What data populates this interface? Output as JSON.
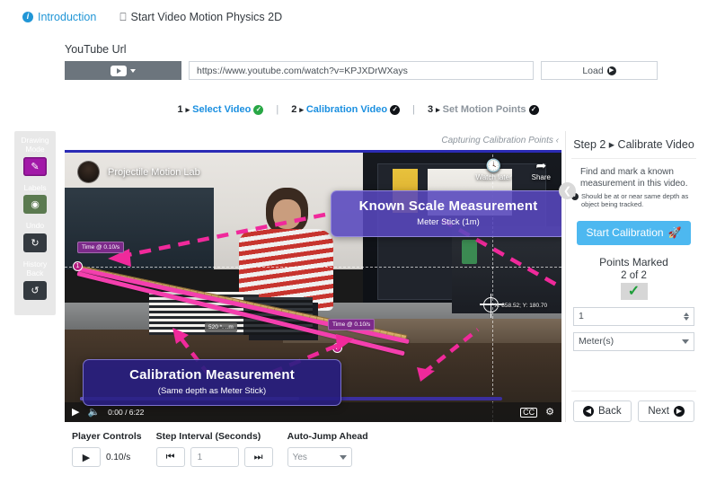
{
  "topnav": {
    "tabs": [
      {
        "label": "Introduction",
        "icon": "info-icon",
        "active": true
      },
      {
        "label": "Start Video Motion Physics 2D",
        "icon": "monitor-icon",
        "active": false
      }
    ]
  },
  "url_form": {
    "label": "YouTube Url",
    "source_button": "youtube-source",
    "value": "https://www.youtube.com/watch?v=KPJXDrWXays",
    "placeholder": "https://www.youtube.com/watch?v=",
    "load_label": "Load"
  },
  "steps": [
    {
      "num": "1",
      "label": "Select Video",
      "state": "done-green"
    },
    {
      "num": "2",
      "label": "Calibration Video",
      "state": "done-black"
    },
    {
      "num": "3",
      "label": "Set Motion Points",
      "state": "muted-black"
    }
  ],
  "toolbar": [
    {
      "label": "Drawing\nMode",
      "label_line1": "Drawing",
      "label_line2": "Mode",
      "icon": "pencil-square-icon",
      "color": "#a219a8"
    },
    {
      "label": "Labels",
      "label_line1": "Labels",
      "label_line2": "",
      "icon": "toggle-icon",
      "color": "#5b7a50"
    },
    {
      "label": "Undo",
      "label_line1": "Undo",
      "label_line2": "",
      "icon": "undo-arrow-icon",
      "color": "#343a40"
    },
    {
      "label": "History Back",
      "label_line1": "History",
      "label_line2": "Back",
      "icon": "history-clock-icon",
      "color": "#343a40"
    }
  ],
  "video": {
    "capturing_label": "Capturing Calibration Points",
    "channel_title": "Projectile Motion Lab",
    "watch_later": "Watch later",
    "share": "Share",
    "time": "0:00 / 6:22",
    "coord_readout": "X: 858.52; Y: 180.70",
    "point_1": "1",
    "point_2": "2",
    "tag_time_top": "Time @ 0.10/s",
    "tag_time_bottom": "Time @ 0.10/s",
    "tag_pixels": "520 *. ..m",
    "callout_known": {
      "title": "Known Scale Measurement",
      "subtitle": "Meter Stick (1m)"
    },
    "callout_calibration": {
      "title": "Calibration Measurement",
      "subtitle": "(Same depth as Meter Stick)"
    }
  },
  "right_panel": {
    "title": "Step 2 ▸ Calibrate Video",
    "description": "Find and mark a known measurement in this video.",
    "note": "Should be at or near same depth as object being tracked.",
    "start_button": "Start Calibration",
    "points_marked_label": "Points Marked",
    "points_marked_count": "2 of 2",
    "distance_value": "1",
    "unit_value": "Meter(s)",
    "back_label": "Back",
    "next_label": "Next"
  },
  "player_controls": {
    "groups": [
      {
        "heading": "Player Controls",
        "rate": "0.10/s"
      },
      {
        "heading": "Step Interval (Seconds)",
        "interval": "1"
      },
      {
        "heading": "Auto-Jump Ahead",
        "value": "Yes"
      }
    ]
  },
  "colors": {
    "accent_blue": "#1a8fe0",
    "button_blue": "#4db8f0",
    "callout_purple": "#5848be",
    "marker_pink": "#f43fae",
    "success_green": "#28a745"
  }
}
